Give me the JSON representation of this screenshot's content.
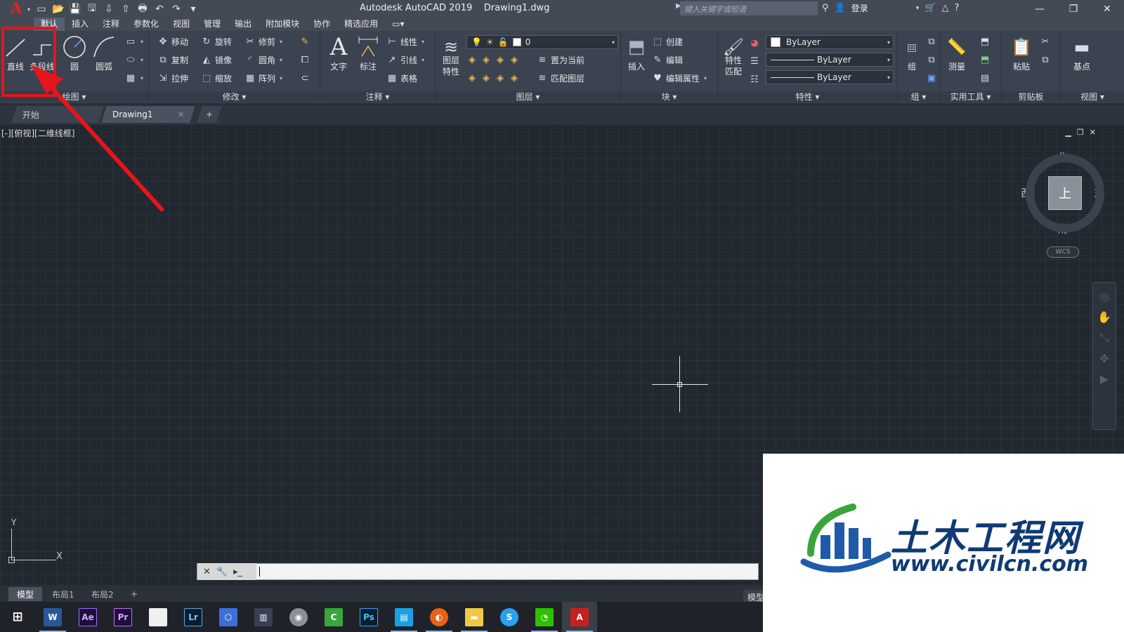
{
  "app": {
    "title": "Autodesk AutoCAD 2019    Drawing1.dwg",
    "search_placeholder": "键入关键字或短语",
    "login": "登录"
  },
  "menu": [
    "默认",
    "插入",
    "注释",
    "参数化",
    "视图",
    "管理",
    "输出",
    "附加模块",
    "协作",
    "精选应用"
  ],
  "ribbon": {
    "draw": {
      "title": "绘图",
      "line": "直线",
      "polyline": "多段线",
      "circle": "圆",
      "arc": "圆弧"
    },
    "modify": {
      "title": "修改",
      "move": "移动",
      "rotate": "旋转",
      "trim": "修剪",
      "copy": "复制",
      "mirror": "镜像",
      "fillet": "圆角",
      "stretch": "拉伸",
      "scale": "缩放",
      "array": "阵列"
    },
    "annotation": {
      "title": "注释",
      "text": "文字",
      "dimension": "标注",
      "linear": "线性",
      "leader": "引线",
      "table": "表格"
    },
    "layers": {
      "title": "图层",
      "properties": "图层\n特性",
      "layer_value": "0",
      "set_current": "置为当前",
      "match_layer": "匹配图层"
    },
    "block": {
      "title": "块",
      "insert": "插入",
      "create": "创建",
      "edit": "编辑",
      "edit_attr": "编辑属性"
    },
    "properties": {
      "title": "特性",
      "match": "特性\n匹配",
      "color": "ByLayer",
      "linetype": "ByLayer",
      "lineweight": "ByLayer"
    },
    "groups": {
      "title": "组",
      "group": "组"
    },
    "utilities": {
      "title": "实用工具",
      "measure": "测量"
    },
    "clipboard": {
      "title": "剪贴板",
      "paste": "粘贴"
    },
    "view": {
      "title": "视图",
      "base": "基点"
    }
  },
  "doc_tabs": {
    "start": "开始",
    "drawing": "Drawing1"
  },
  "viewport": {
    "label": "[-][俯视][二维线框]",
    "compass": {
      "north": "北",
      "south": "南",
      "east": "东",
      "west": "西",
      "top": "上"
    },
    "wcs": "WCS",
    "ucs_x": "X",
    "ucs_y": "Y"
  },
  "layout_tabs": [
    "模型",
    "布局1",
    "布局2"
  ],
  "status_model": "模型",
  "taskbar": [
    "windows",
    "word",
    "after-effects",
    "premiere",
    "file",
    "lightroom",
    "app-blue",
    "app-dark",
    "app-gray",
    "camtasia",
    "photoshop",
    "app-cyan",
    "firefox",
    "explorer",
    "app-sky",
    "wechat",
    "autocad"
  ],
  "watermark": {
    "title": "土木工程网",
    "url": "www.civilcn.com"
  },
  "colors": {
    "accent": "#e6141c",
    "background": "#212830",
    "ribbon": "#3b4350"
  }
}
